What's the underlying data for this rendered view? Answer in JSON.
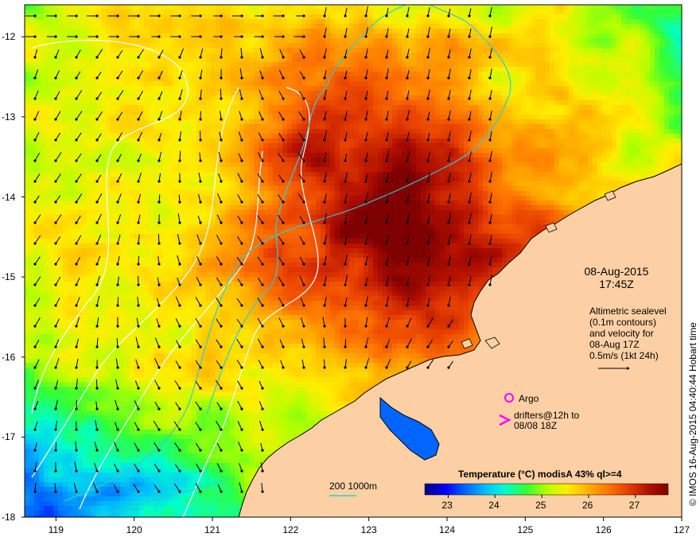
{
  "colors": {
    "land": "#fcd0a4",
    "coast": "#000000",
    "contour_white": "#ffffff",
    "depth_contour": "#33cccc",
    "argo": "#ff00ff",
    "drifter": "#ff00ff"
  },
  "axes": {
    "lat_ticks": [
      "-12",
      "-13",
      "-14",
      "-15",
      "-16",
      "-17",
      "-18"
    ],
    "lon_ticks": [
      "119",
      "120",
      "121",
      "122",
      "123",
      "124",
      "125",
      "126",
      "127"
    ]
  },
  "annotations": {
    "date": "08-Aug-2015",
    "time": "17:45Z",
    "altimetry_line1": "Altimetric sealevel",
    "altimetry_line2": "(0.1m contours)",
    "altimetry_line3": "and velocity for",
    "altimetry_line4": "08-Aug 17Z",
    "altimetry_line5": "0.5m/s (1kt 24h)",
    "argo_label": "Argo",
    "drifter_line1": "drifters@12h to",
    "drifter_line2": "08/08 18Z",
    "depth_legend": "200  1000m",
    "credit": "© IMOS 16-Aug-2015 04:40:44 Hobart time"
  },
  "colorbar": {
    "title_part1": "Temperature  (°C)",
    "title_part2": " modisA 43% ql>=4",
    "ticks": [
      "23",
      "24",
      "25",
      "26",
      "27"
    ],
    "vmin": 22.5,
    "vmax": 27.7,
    "colors": [
      "#00007f",
      "#0000ff",
      "#0066ff",
      "#00bfff",
      "#00ffcc",
      "#33ff33",
      "#b3ff00",
      "#ffee00",
      "#ffb300",
      "#ff7700",
      "#e84000",
      "#b31000",
      "#7f0000"
    ]
  },
  "icons": {
    "argo_marker": "circle",
    "drifter_marker": "chevron"
  }
}
